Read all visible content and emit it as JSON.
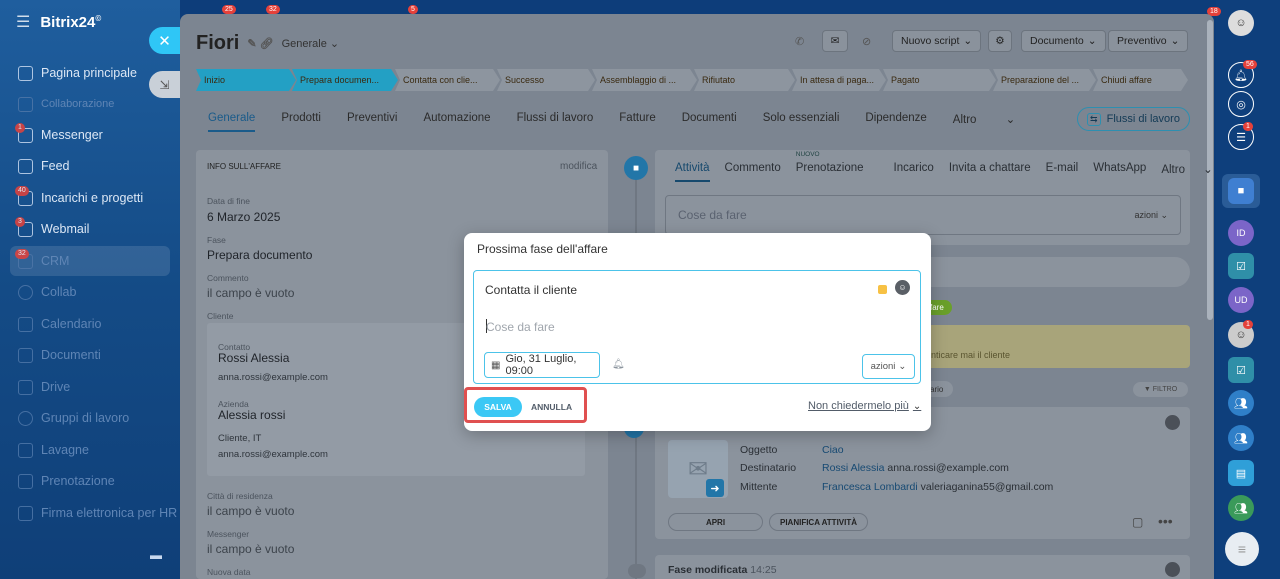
{
  "sidebar": {
    "brand": "Bitrix24",
    "brand_sup": "©",
    "items": [
      {
        "label": "Pagina principale",
        "badge": ""
      },
      {
        "label": "Collaborazione",
        "badge": ""
      },
      {
        "label": "Messenger",
        "badge": "1"
      },
      {
        "label": "Feed",
        "badge": ""
      },
      {
        "label": "Incarichi e progetti",
        "badge": "40"
      },
      {
        "label": "Webmail",
        "badge": "3"
      },
      {
        "label": "CRM",
        "badge": "32"
      },
      {
        "label": "Collab",
        "badge": ""
      },
      {
        "label": "Calendario",
        "badge": ""
      },
      {
        "label": "Documenti",
        "badge": ""
      },
      {
        "label": "Drive",
        "badge": ""
      },
      {
        "label": "Gruppi di lavoro",
        "badge": ""
      },
      {
        "label": "Lavagne",
        "badge": ""
      },
      {
        "label": "Prenotazione",
        "badge": ""
      },
      {
        "label": "Firma elettronica per HR",
        "badge": ""
      }
    ],
    "top_badges": [
      "25",
      "32",
      "5"
    ]
  },
  "header": {
    "title": "Fiori",
    "category": "Generale",
    "buttons": {
      "script": "Nuovo script",
      "document": "Documento",
      "quote": "Preventivo"
    }
  },
  "stages": [
    {
      "label": "Inizio",
      "color": "#23a0c4"
    },
    {
      "label": "Prepara documen...",
      "color": "#23a0c4"
    },
    {
      "label": "Contatta con clie...",
      "color": "#8d959f"
    },
    {
      "label": "Successo",
      "color": "#8d959f"
    },
    {
      "label": "Assemblaggio di ...",
      "color": "#8d959f"
    },
    {
      "label": "Rifiutato",
      "color": "#8d959f"
    },
    {
      "label": "In attesa di paga...",
      "color": "#8d959f"
    },
    {
      "label": "Pagato",
      "color": "#8d959f"
    },
    {
      "label": "Preparazione del ...",
      "color": "#8d959f"
    },
    {
      "label": "Chiudi affare",
      "color": "#8d959f"
    }
  ],
  "tabs": [
    "Generale",
    "Prodotti",
    "Preventivi",
    "Automazione",
    "Flussi di lavoro",
    "Fatture",
    "Documenti",
    "Solo essenziali",
    "Dipendenze",
    "Altro"
  ],
  "workflows_button": "Flussi di lavoro",
  "info": {
    "heading": "INFO SULL'AFFARE",
    "edit": "modifica",
    "end_date_label": "Data di fine",
    "end_date": "6 Marzo 2025",
    "stage_label": "Fase",
    "stage": "Prepara documento",
    "comment_label": "Commento",
    "comment": "il campo è vuoto",
    "client_label": "Cliente",
    "contact_label": "Contatto",
    "contact_name": "Rossi Alessia",
    "contact_email": "anna.rossi@example.com",
    "company_label": "Azienda",
    "company_name": "Alessia rossi",
    "company_type": "Cliente, IT",
    "company_email": "anna.rossi@example.com",
    "city_label": "Città di residenza",
    "city": "il campo è vuoto",
    "messenger_label": "Messenger",
    "messenger": "il campo è vuoto",
    "new_date_label": "Nuova data"
  },
  "activity": {
    "tabs": [
      "Attività",
      "Commento",
      "Prenotazione",
      "Incarico",
      "Invita a chattare",
      "E-mail",
      "WhatsApp",
      "Altro"
    ],
    "new_tag": "NUOVO",
    "todo_placeholder": "Cose da fare",
    "todo_actions": "azioni",
    "green_tag": "fare",
    "note_text": "nticare mai il cliente",
    "filter_tag": "ario",
    "filter_label": "FILTRO",
    "email": {
      "subject_label": "Oggetto",
      "subject": "Ciao",
      "recipient_label": "Destinatario",
      "recipient_name": "Rossi Alessia",
      "recipient_email": "anna.rossi@example.com",
      "sender_label": "Mittente",
      "sender_name": "Francesca Lombardi",
      "sender_email": "valeriaganina55@gmail.com",
      "open_btn": "APRI",
      "plan_btn": "PIANIFICA ATTIVITÀ"
    },
    "stage_changed": "Fase modificata",
    "stage_changed_time": "14:25"
  },
  "modal": {
    "title": "Prossima fase dell'affare",
    "activity": "Contatta il cliente",
    "placeholder": "Cose da fare",
    "date": "Gio, 31 Luglio, 09:00",
    "actions": "azioni",
    "save": "SALVA",
    "cancel": "ANNULLA",
    "dont_ask": "Non chiedermelo più"
  },
  "rightbar": {
    "badges": [
      "18",
      "56",
      "1",
      "1"
    ],
    "avatar_initials": [
      "ID",
      "UD"
    ]
  }
}
